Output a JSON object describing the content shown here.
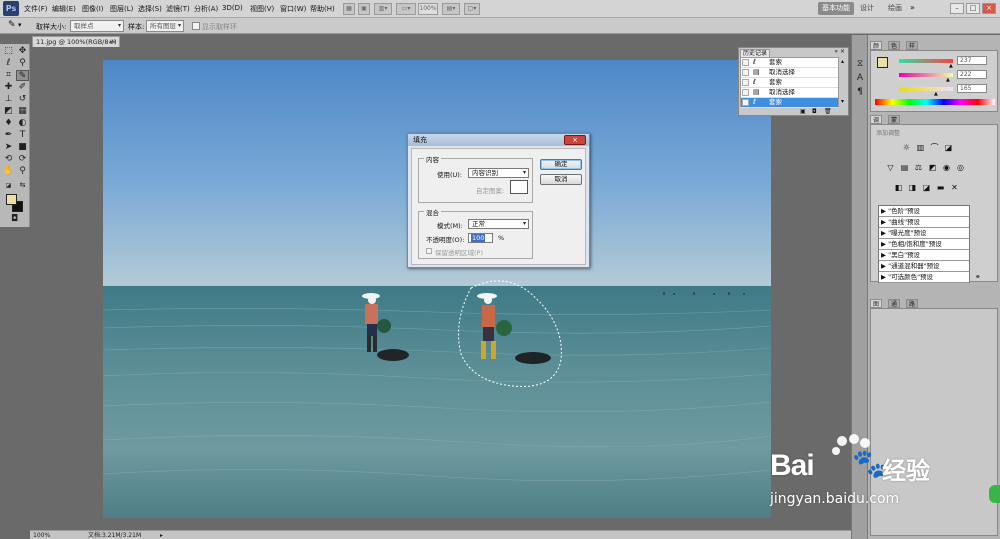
{
  "menubar": {
    "logo": "Ps",
    "items": [
      "文件(F)",
      "编辑(E)",
      "图像(I)",
      "图层(L)",
      "选择(S)",
      "滤镜(T)",
      "分析(A)",
      "3D(D)",
      "视图(V)",
      "窗口(W)",
      "帮助(H)"
    ],
    "zoom": "100%",
    "workspaces": [
      "基本功能",
      "设计",
      "绘画"
    ],
    "active_workspace": "基本功能",
    "window_buttons": [
      "–",
      "□",
      "×"
    ]
  },
  "options": {
    "sample_size_label": "取样大小:",
    "sample_size_value": "取样点",
    "sample_label": "样本:",
    "sample_value": "所有图层",
    "ring_label": "显示取样环"
  },
  "document": {
    "tab_title": "11.jpg @ 100%(RGB/8#)",
    "tab_close": "×",
    "status_zoom": "100%",
    "status_doc": "文档:3.21M/3.21M"
  },
  "fill_dialog": {
    "title": "填充",
    "content_group": "内容",
    "use_label": "使用(U):",
    "use_value": "内容识别",
    "custom_pattern_label": "自定图案:",
    "blend_group": "混合",
    "mode_label": "模式(M):",
    "mode_value": "正常",
    "opacity_label": "不透明度(O):",
    "opacity_value": "100",
    "opacity_unit": "%",
    "preserve_label": "保留透明区域(P)",
    "ok_button": "确定",
    "cancel_button": "取消"
  },
  "history": {
    "tab": "历史记录",
    "rows": [
      {
        "label": "套索",
        "icon": "lasso-icon"
      },
      {
        "label": "取消选择",
        "icon": "document-icon"
      },
      {
        "label": "套索",
        "icon": "lasso-icon"
      },
      {
        "label": "取消选择",
        "icon": "document-icon"
      },
      {
        "label": "套索",
        "icon": "lasso-icon"
      }
    ],
    "active_index": 4
  },
  "color_panel": {
    "tabs": [
      "颜色",
      "色板",
      "样式"
    ],
    "values": [
      "237",
      "222",
      "165"
    ],
    "foreground_color": "#edde a5",
    "slider_colors": [
      "#ff4040",
      "#40d040",
      "#4060ff"
    ]
  },
  "adjust_panel": {
    "tabs": [
      "调整",
      "蒙版"
    ],
    "hint": "添加调整",
    "presets": [
      "\"色阶\"预设",
      "\"曲线\"预设",
      "\"曝光度\"预设",
      "\"色相/饱和度\"预设",
      "\"黑白\"预设",
      "\"通道混和器\"预设",
      "\"可选颜色\"预设"
    ]
  },
  "layers_panel": {
    "tabs": [
      "图层",
      "通道",
      "路径"
    ]
  },
  "watermark": {
    "brand": "Bai",
    "brand2": "经验",
    "url": "jingyan.baidu.com"
  },
  "colors": {
    "accent": "#3e8ee0",
    "foreground_swatch": "#edde a5"
  }
}
